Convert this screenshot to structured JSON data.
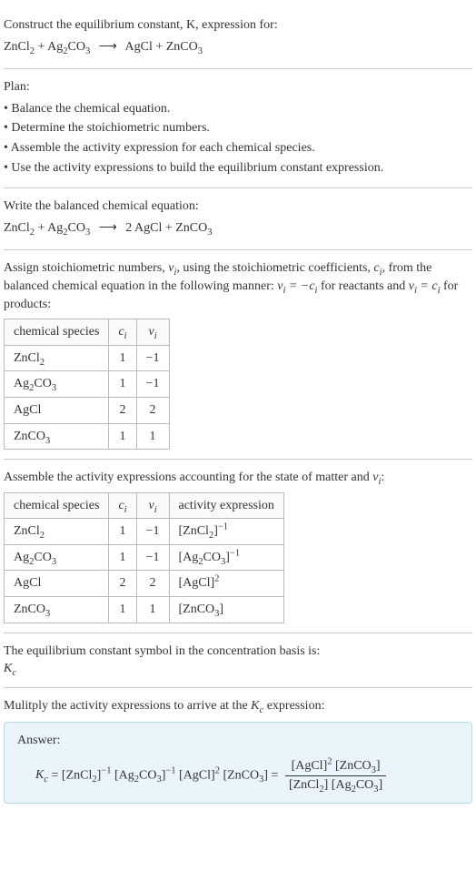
{
  "prompt": {
    "line1": "Construct the equilibrium constant, K, expression for:",
    "reaction_unbalanced": "ZnCl₂ + Ag₂CO₃ ⟶ AgCl + ZnCO₃"
  },
  "plan": {
    "heading": "Plan:",
    "items": [
      "• Balance the chemical equation.",
      "• Determine the stoichiometric numbers.",
      "• Assemble the activity expression for each chemical species.",
      "• Use the activity expressions to build the equilibrium constant expression."
    ]
  },
  "balanced": {
    "intro": "Write the balanced chemical equation:",
    "equation": "ZnCl₂ + Ag₂CO₃ ⟶ 2 AgCl + ZnCO₃"
  },
  "stoich": {
    "intro_part1": "Assign stoichiometric numbers, ",
    "intro_nu": "νᵢ",
    "intro_part2": ", using the stoichiometric coefficients, ",
    "intro_c": "cᵢ",
    "intro_part3": ", from the balanced chemical equation in the following manner: ",
    "intro_rel1": "νᵢ = −cᵢ",
    "intro_part4": " for reactants and ",
    "intro_rel2": "νᵢ = cᵢ",
    "intro_part5": " for products:",
    "headers": {
      "species": "chemical species",
      "c": "cᵢ",
      "nu": "νᵢ"
    },
    "rows": [
      {
        "species": "ZnCl₂",
        "c": "1",
        "nu": "−1"
      },
      {
        "species": "Ag₂CO₃",
        "c": "1",
        "nu": "−1"
      },
      {
        "species": "AgCl",
        "c": "2",
        "nu": "2"
      },
      {
        "species": "ZnCO₃",
        "c": "1",
        "nu": "1"
      }
    ]
  },
  "activity": {
    "intro": "Assemble the activity expressions accounting for the state of matter and νᵢ:",
    "headers": {
      "species": "chemical species",
      "c": "cᵢ",
      "nu": "νᵢ",
      "expr": "activity expression"
    },
    "rows": [
      {
        "species": "ZnCl₂",
        "c": "1",
        "nu": "−1",
        "expr": "[ZnCl₂]⁻¹"
      },
      {
        "species": "Ag₂CO₃",
        "c": "1",
        "nu": "−1",
        "expr": "[Ag₂CO₃]⁻¹"
      },
      {
        "species": "AgCl",
        "c": "2",
        "nu": "2",
        "expr": "[AgCl]²"
      },
      {
        "species": "ZnCO₃",
        "c": "1",
        "nu": "1",
        "expr": "[ZnCO₃]"
      }
    ]
  },
  "kc_symbol": {
    "intro": "The equilibrium constant symbol in the concentration basis is:",
    "symbol": "K_c"
  },
  "multiply": {
    "intro": "Mulitply the activity expressions to arrive at the K_c expression:"
  },
  "answer": {
    "label": "Answer:",
    "lhs": "K_c = [ZnCl₂]⁻¹ [Ag₂CO₃]⁻¹ [AgCl]² [ZnCO₃] = ",
    "num": "[AgCl]² [ZnCO₃]",
    "den": "[ZnCl₂] [Ag₂CO₃]"
  },
  "chart_data": {
    "type": "table",
    "title": "Stoichiometric numbers and activity expressions for ZnCl2 + Ag2CO3 -> 2 AgCl + ZnCO3",
    "columns": [
      "chemical species",
      "c_i",
      "nu_i",
      "activity expression"
    ],
    "rows": [
      [
        "ZnCl2",
        1,
        -1,
        "[ZnCl2]^-1"
      ],
      [
        "Ag2CO3",
        1,
        -1,
        "[Ag2CO3]^-1"
      ],
      [
        "AgCl",
        2,
        2,
        "[AgCl]^2"
      ],
      [
        "ZnCO3",
        1,
        1,
        "[ZnCO3]"
      ]
    ]
  }
}
